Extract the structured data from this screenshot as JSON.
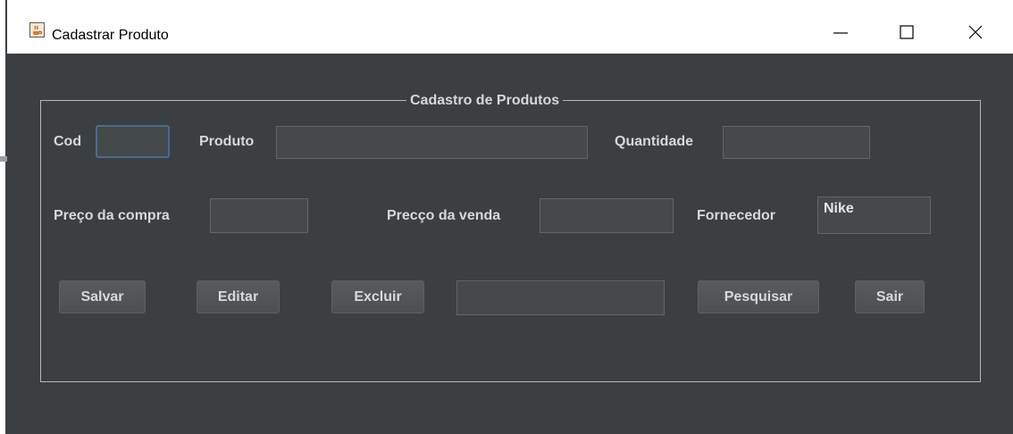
{
  "window": {
    "title": "Cadastrar Produto",
    "icon": "java-cup-icon",
    "controls": [
      "minimize-icon",
      "maximize-icon",
      "close-icon"
    ]
  },
  "panel": {
    "legend": "Cadastro de Produtos"
  },
  "form": {
    "cod_label": "Cod",
    "cod_value": "",
    "produto_label": "Produto",
    "produto_value": "",
    "quantidade_label": "Quantidade",
    "quantidade_value": "",
    "preco_compra_label": "Preço da compra",
    "preco_compra_value": "",
    "preco_venda_label": "Precço da venda",
    "preco_venda_value": "",
    "fornecedor_label": "Fornecedor",
    "fornecedor_value": "Nike",
    "search_value": ""
  },
  "buttons": {
    "salvar": "Salvar",
    "editar": "Editar",
    "excluir": "Excluir",
    "pesquisar": "Pesquisar",
    "sair": "Sair"
  },
  "colors": {
    "background": "#3c3f41",
    "field_background": "#45494a",
    "text": "#d6d9dc",
    "focus_border": "#466d94"
  }
}
